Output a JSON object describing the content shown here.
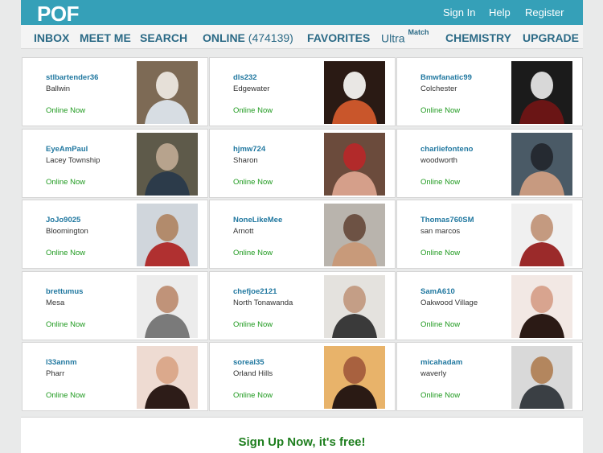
{
  "header": {
    "logo": "POF",
    "links": [
      "Sign In",
      "Help",
      "Register"
    ]
  },
  "nav": {
    "inbox": "INBOX",
    "meet_me": "MEET ME",
    "search": "SEARCH",
    "online": "ONLINE",
    "online_count": "(474139)",
    "favorites": "FAVORITES",
    "ultra": "Ultra",
    "ultra_sup": "Match",
    "chemistry": "CHEMISTRY",
    "upgrade": "UPGRADE"
  },
  "profiles": [
    {
      "username": "stlbartender36",
      "city": "Ballwin",
      "status": "Online Now"
    },
    {
      "username": "dls232",
      "city": "Edgewater",
      "status": "Online Now"
    },
    {
      "username": "Bmwfanatic99",
      "city": "Colchester",
      "status": "Online Now"
    },
    {
      "username": "EyeAmPaul",
      "city": "Lacey Township",
      "status": "Online Now"
    },
    {
      "username": "hjmw724",
      "city": "Sharon",
      "status": "Online Now"
    },
    {
      "username": "charliefonteno",
      "city": "woodworth",
      "status": "Online Now"
    },
    {
      "username": "JoJo9025",
      "city": "Bloomington",
      "status": "Online Now"
    },
    {
      "username": "NoneLikeMee",
      "city": "Arnott",
      "status": "Online Now"
    },
    {
      "username": "Thomas760SM",
      "city": "san marcos",
      "status": "Online Now"
    },
    {
      "username": "brettumus",
      "city": "Mesa",
      "status": "Online Now"
    },
    {
      "username": "chefjoe2121",
      "city": "North Tonawanda",
      "status": "Online Now"
    },
    {
      "username": "SamA610",
      "city": "Oakwood Village",
      "status": "Online Now"
    },
    {
      "username": "l33annm",
      "city": "Pharr",
      "status": "Online Now"
    },
    {
      "username": "soreal35",
      "city": "Orland Hills",
      "status": "Online Now"
    },
    {
      "username": "micahadam",
      "city": "waverly",
      "status": "Online Now"
    }
  ],
  "footer": {
    "signup": "Sign Up Now, it's free!"
  },
  "colors": {
    "brand": "#35a0b8",
    "nav_text": "#2b6a86",
    "username": "#2178a0",
    "online": "#1f9a1f"
  }
}
